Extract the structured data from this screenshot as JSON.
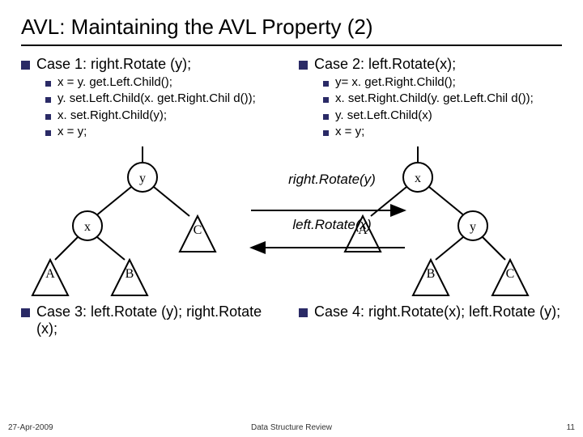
{
  "title": "AVL: Maintaining the AVL Property (2)",
  "case1": {
    "header": "Case 1: right.Rotate (y);",
    "steps": [
      "x = y. get.Left.Child();",
      "y. set.Left.Child(x. get.Right.Chil d());",
      "x. set.Right.Child(y);",
      "x = y;"
    ]
  },
  "case2": {
    "header": "Case 2: left.Rotate(x);",
    "steps": [
      "y= x. get.Right.Child();",
      "x. set.Right.Child(y. get.Left.Chil d());",
      "y. set.Left.Child(x)",
      "x = y;"
    ]
  },
  "diag_left": {
    "top": "y",
    "left": "x",
    "right": "C",
    "ll": "A",
    "lr": "B"
  },
  "diag_right": {
    "top": "x",
    "left": "A",
    "right": "y",
    "rl": "B",
    "rr": "C"
  },
  "arrows": {
    "a1": "right.Rotate(y)",
    "a2": "left.Rotate(x)"
  },
  "case3": "Case 3: left.Rotate (y); right.Rotate (x);",
  "case4": "Case 4: right.Rotate(x); left.Rotate (y);",
  "footer": {
    "date": "27-Apr-2009",
    "center": "Data Structure Review",
    "page": "11"
  }
}
